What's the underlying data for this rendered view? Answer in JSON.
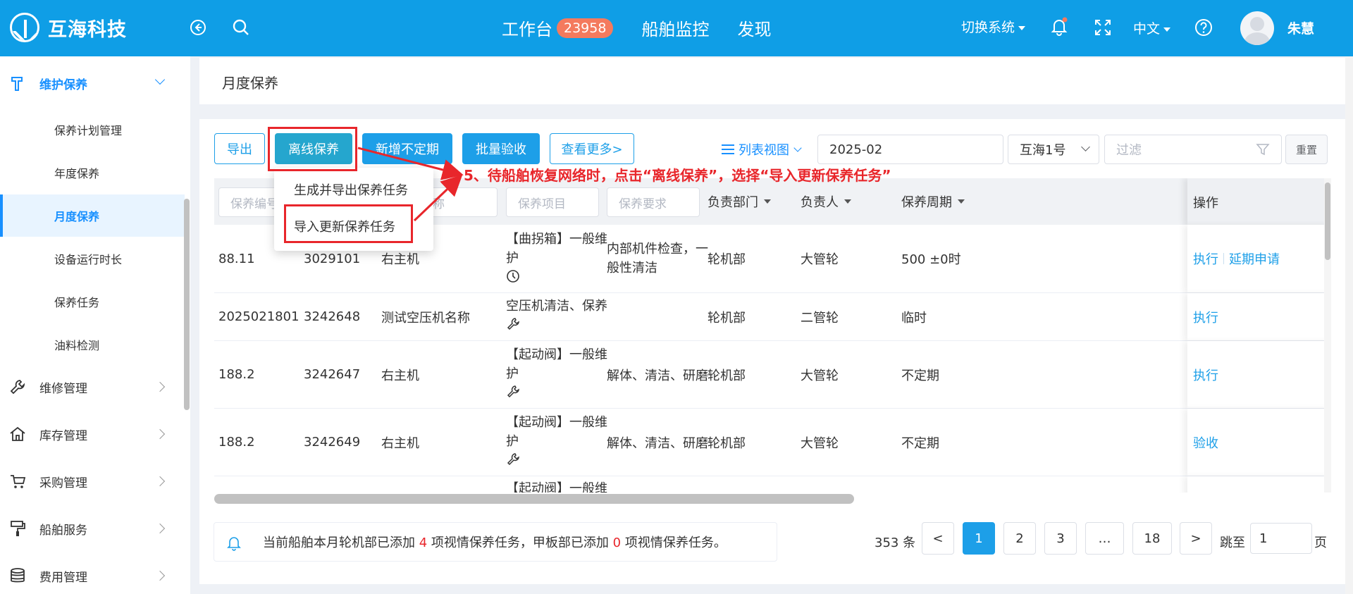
{
  "topbar": {
    "logo_text": "互海科技",
    "nav": [
      {
        "label": "工作台",
        "badge": "23958"
      },
      {
        "label": "船舶监控"
      },
      {
        "label": "发现"
      }
    ],
    "switch_system": "切换系统",
    "language": "中文",
    "user_name": "朱慧",
    "colors": {
      "bar": "#0f9ee6",
      "badge": "#f47a5e",
      "notify_dot": "#f47a5e"
    }
  },
  "sidebar": {
    "groups": [
      {
        "label": "维护保养",
        "icon": "hammer-icon",
        "open": true
      },
      {
        "label": "维修管理",
        "icon": "wrench-icon"
      },
      {
        "label": "库存管理",
        "icon": "home-icon"
      },
      {
        "label": "采购管理",
        "icon": "cart-icon"
      },
      {
        "label": "船舶服务",
        "icon": "paint-roller-icon"
      },
      {
        "label": "费用管理",
        "icon": "coins-icon"
      }
    ],
    "sub_items": [
      "保养计划管理",
      "年度保养",
      "月度保养",
      "设备运行时长",
      "保养任务",
      "油料检测"
    ],
    "active_sub": "月度保养"
  },
  "breadcrumb": {
    "title": "月度保养"
  },
  "toolbar": {
    "export": "导出",
    "offline_maintenance": "离线保养",
    "add_irregular": "新增不定期",
    "batch_accept": "批量验收",
    "view_more": "查看更多>",
    "view_mode": "列表视图",
    "month": "2025-02",
    "ship": "互海1号",
    "filter_placeholder": "过滤",
    "reset": "重置"
  },
  "dropdown": {
    "items": [
      "生成并导出保养任务",
      "导入更新保养任务"
    ]
  },
  "annotation": "5、待船舶恢复网络时，点击“离线保养”，选择“导入更新保养任务”",
  "table": {
    "filter_placeholders": [
      "保养编号",
      "设备名称",
      "保养项目",
      "保养要求"
    ],
    "sort_headers": [
      "负责部门",
      "负责人",
      "保养周期"
    ],
    "op_header": "操作",
    "rows": [
      {
        "no": "88.11",
        "code": "3029101",
        "equip": "右主机",
        "item_l1": "【曲拐箱】一般维",
        "item_l2": "护",
        "icon": "clock-icon",
        "req_l1": "内部机件检查，一",
        "req_l2": "般性清洁",
        "dept": "轮机部",
        "owner": "大管轮",
        "cycle": "500 ±0时",
        "ops": [
          "执行",
          "延期申请"
        ]
      },
      {
        "no": "2025021801",
        "code": "3242648",
        "equip": "测试空压机名称",
        "item_l1": "空压机清洁、保养",
        "item_l2": "",
        "icon": "wrench-icon",
        "req_l1": "",
        "req_l2": "",
        "dept": "轮机部",
        "owner": "二管轮",
        "cycle": "临时",
        "ops": [
          "执行"
        ]
      },
      {
        "no": "188.2",
        "code": "3242647",
        "equip": "右主机",
        "item_l1": "【起动阀】一般维",
        "item_l2": "护",
        "icon": "wrench-icon",
        "req_l1": "解体、清洁、研磨",
        "req_l2": "",
        "dept": "轮机部",
        "owner": "大管轮",
        "cycle": "不定期",
        "ops": [
          "执行"
        ]
      },
      {
        "no": "188.2",
        "code": "3242649",
        "equip": "右主机",
        "item_l1": "【起动阀】一般维",
        "item_l2": "护",
        "icon": "wrench-icon",
        "req_l1": "解体、清洁、研磨",
        "req_l2": "",
        "dept": "轮机部",
        "owner": "大管轮",
        "cycle": "不定期",
        "ops": [
          "验收"
        ]
      },
      {
        "no": "",
        "code": "",
        "equip": "",
        "item_l1": "【起动阀】一般维",
        "item_l2": "",
        "icon": "",
        "req_l1": "",
        "req_l2": "",
        "dept": "",
        "owner": "",
        "cycle": "",
        "ops": []
      }
    ]
  },
  "notice": {
    "part1": "当前船舶本月轮机部已添加 ",
    "engine_count": "4",
    "part2": " 项视情保养任务，甲板部已添加 ",
    "deck_count": "0",
    "part3": " 项视情保养任务。"
  },
  "pagination": {
    "total": "353 条",
    "prev": "<",
    "pages": [
      "1",
      "2",
      "3",
      "…",
      "18"
    ],
    "current": "1",
    "next": ">",
    "jump_label": "跳至",
    "jump_value": "1",
    "unit": "页"
  }
}
